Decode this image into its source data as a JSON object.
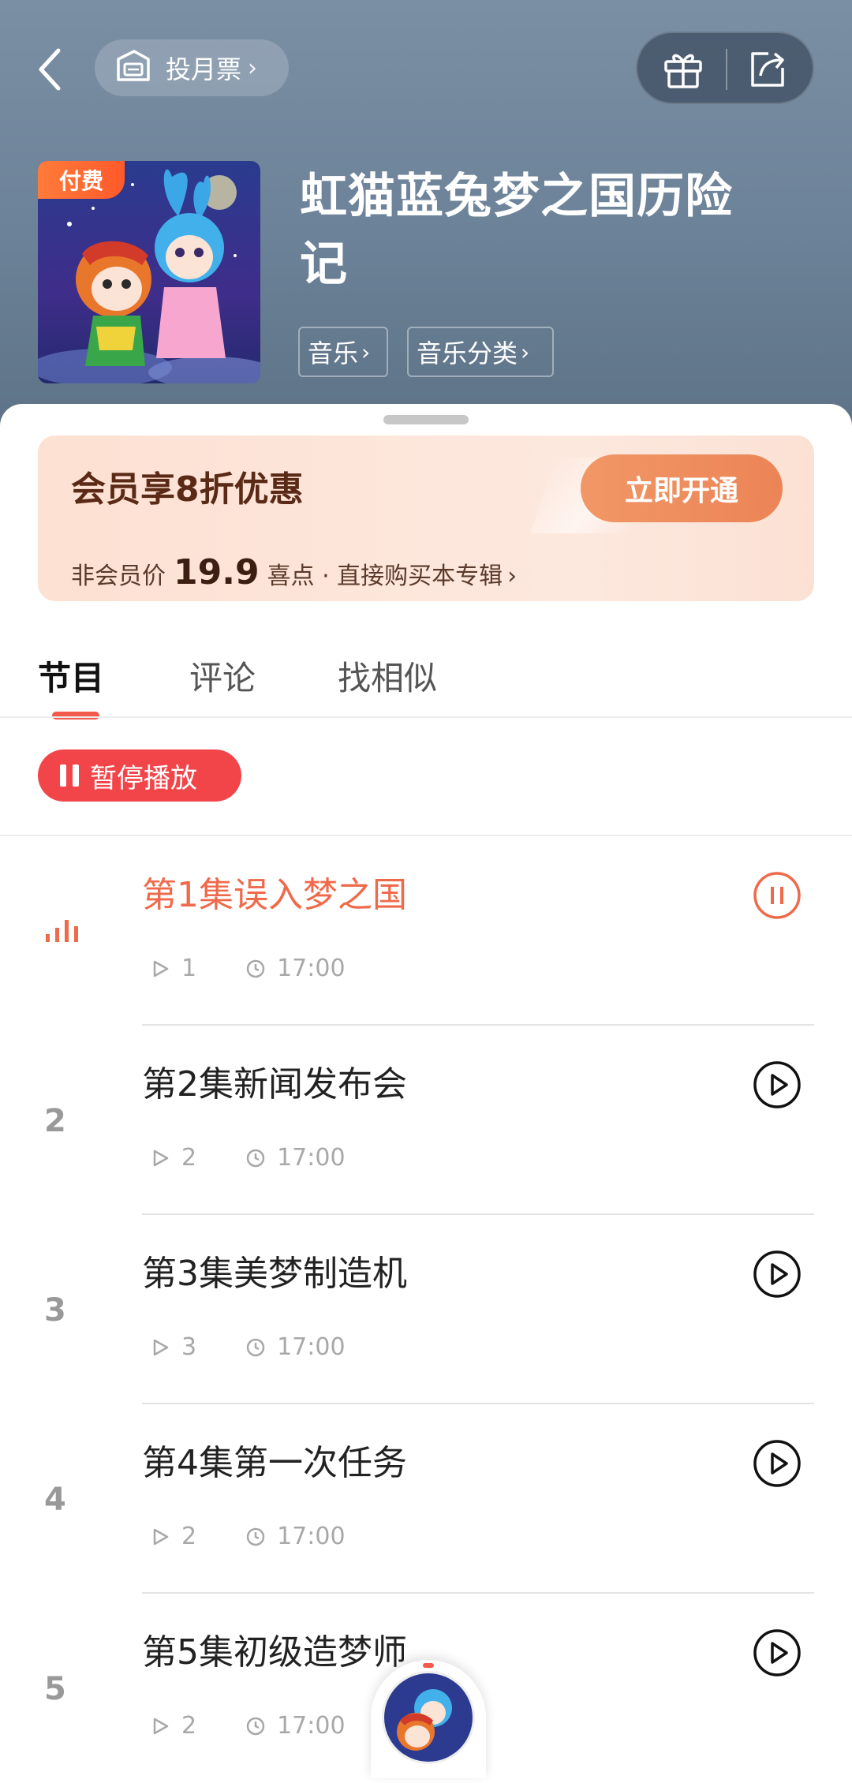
{
  "header": {
    "vote_label": "投月票",
    "paid_badge": "付费",
    "title_line1": "虹猫蓝兔梦之国历险",
    "title_line2": "记",
    "tags": [
      "音乐",
      "音乐分类"
    ],
    "bg_color": "#6c8298"
  },
  "promo": {
    "title": "会员享8折优惠",
    "button": "立即开通",
    "sub_prefix": "非会员价",
    "price": "19.9",
    "sub_suffix": "喜点 · 直接购买本专辑"
  },
  "tabs": [
    {
      "label": "节目",
      "active": true
    },
    {
      "label": "评论",
      "active": false
    },
    {
      "label": "找相似",
      "active": false
    }
  ],
  "pause_all_label": "暂停播放",
  "episodes": [
    {
      "index": "1",
      "title": "第1集误入梦之国",
      "plays": "1",
      "duration": "17:00",
      "state": "playing"
    },
    {
      "index": "2",
      "title": "第2集新闻发布会",
      "plays": "2",
      "duration": "17:00",
      "state": "idle"
    },
    {
      "index": "3",
      "title": "第3集美梦制造机",
      "plays": "3",
      "duration": "17:00",
      "state": "idle"
    },
    {
      "index": "4",
      "title": "第4集第一次任务",
      "plays": "2",
      "duration": "17:00",
      "state": "idle"
    },
    {
      "index": "5",
      "title": "第5集初级造梦师",
      "plays": "2",
      "duration": "17:00",
      "state": "idle"
    }
  ],
  "colors": {
    "accent": "#f2454a",
    "playing_text": "#ef6a4b",
    "promo_button": "#ec8456"
  },
  "icons": {
    "back": "chevron-left-icon",
    "vote": "ticket-icon",
    "gift": "gift-icon",
    "share": "share-icon",
    "equalizer": "equalizer-icon",
    "pause": "pause-circle-icon",
    "play": "play-circle-icon",
    "plays": "play-count-icon",
    "duration": "clock-icon"
  }
}
